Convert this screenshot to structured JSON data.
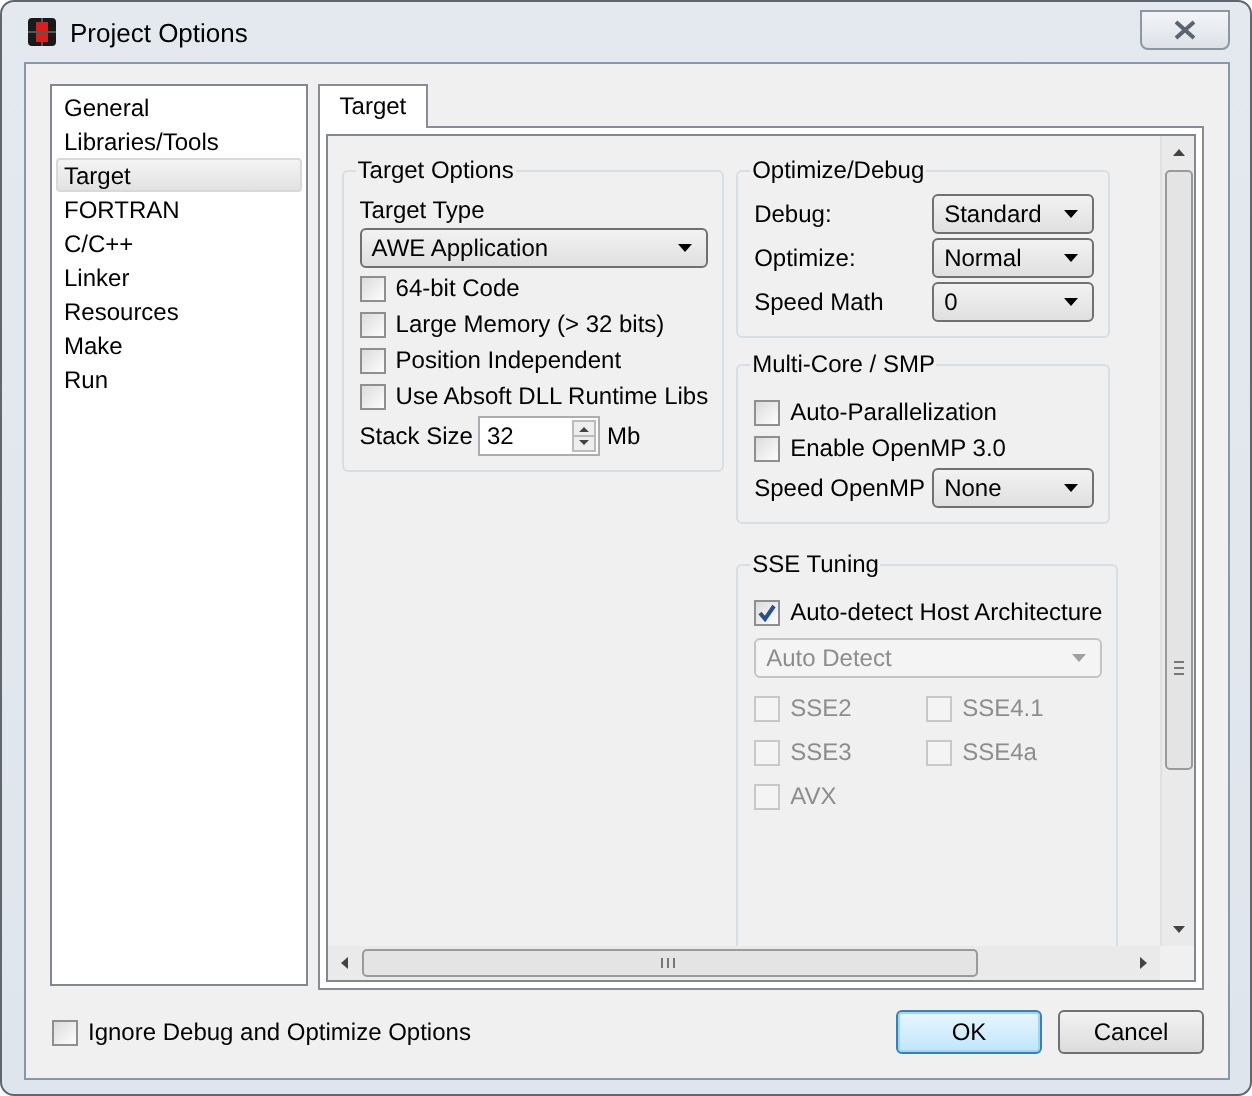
{
  "window": {
    "title": "Project Options"
  },
  "sidebar": {
    "items": [
      {
        "label": "General",
        "selected": false
      },
      {
        "label": "Libraries/Tools",
        "selected": false
      },
      {
        "label": "Target",
        "selected": true
      },
      {
        "label": "FORTRAN",
        "selected": false
      },
      {
        "label": "C/C++",
        "selected": false
      },
      {
        "label": "Linker",
        "selected": false
      },
      {
        "label": "Resources",
        "selected": false
      },
      {
        "label": "Make",
        "selected": false
      },
      {
        "label": "Run",
        "selected": false
      }
    ]
  },
  "tabs": [
    {
      "label": "Target",
      "selected": true
    }
  ],
  "target_options": {
    "title": "Target Options",
    "target_type": {
      "label": "Target Type",
      "value": "AWE Application"
    },
    "checkboxes": [
      {
        "label": "64-bit Code",
        "checked": false
      },
      {
        "label": "Large Memory (> 32 bits)",
        "checked": false
      },
      {
        "label": "Position Independent",
        "checked": false
      },
      {
        "label": "Use Absoft DLL Runtime Libs",
        "checked": false
      }
    ],
    "stack_size": {
      "label": "Stack Size",
      "value": "32",
      "unit": "Mb"
    }
  },
  "optimize_debug": {
    "title": "Optimize/Debug",
    "fields": [
      {
        "label": "Debug:",
        "value": "Standard"
      },
      {
        "label": "Optimize:",
        "value": "Normal"
      },
      {
        "label": "Speed Math",
        "value": "0"
      }
    ]
  },
  "multi_core": {
    "title": "Multi-Core / SMP",
    "checkboxes": [
      {
        "label": "Auto-Parallelization",
        "checked": false
      },
      {
        "label": "Enable OpenMP 3.0",
        "checked": false
      }
    ],
    "speed_openmp": {
      "label": "Speed OpenMP",
      "value": "None"
    }
  },
  "sse_tuning": {
    "title": "SSE Tuning",
    "auto_detect": {
      "label": "Auto-detect Host Architecture",
      "checked": true
    },
    "architecture": {
      "value": "Auto Detect",
      "disabled": true
    },
    "checkboxes": [
      {
        "label": "SSE2",
        "checked": false,
        "disabled": true
      },
      {
        "label": "SSE4.1",
        "checked": false,
        "disabled": true
      },
      {
        "label": "SSE3",
        "checked": false,
        "disabled": true
      },
      {
        "label": "SSE4a",
        "checked": false,
        "disabled": true
      },
      {
        "label": "AVX",
        "checked": false,
        "disabled": true
      }
    ]
  },
  "footer": {
    "ignore_option": {
      "label": "Ignore Debug and Optimize Options",
      "checked": false
    },
    "buttons": [
      {
        "label": "OK",
        "default": true
      },
      {
        "label": "Cancel",
        "default": false
      }
    ]
  }
}
